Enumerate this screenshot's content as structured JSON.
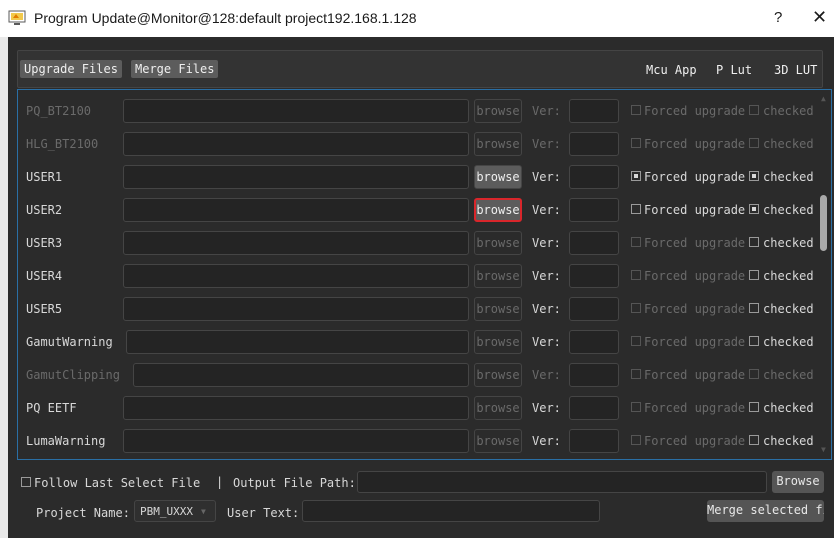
{
  "window": {
    "title": "Program Update@Monitor@128:default project192.168.1.128",
    "help_label": "?",
    "close_label": "✕"
  },
  "top_tabs": {
    "upgrade_files": "Upgrade Files",
    "merge_files": "Merge Files",
    "mcu_app": "Mcu App",
    "p_lut": "P Lut",
    "lut_3d": "3D LUT"
  },
  "labels": {
    "browse": "browse",
    "ver": "Ver:",
    "forced_upgrade": "Forced upgrade",
    "checked": "checked"
  },
  "rows": [
    {
      "name": "PQ_BT2100",
      "enabled": false,
      "forced": false,
      "checked": false
    },
    {
      "name": "HLG_BT2100",
      "enabled": false,
      "forced": false,
      "checked": false
    },
    {
      "name": "USER1",
      "enabled": true,
      "forced": true,
      "checked": true,
      "browse_highlight": true
    },
    {
      "name": "USER2",
      "enabled": true,
      "forced": false,
      "checked": true,
      "browse_focused": true
    },
    {
      "name": "USER3",
      "enabled": true,
      "forced": false,
      "checked": false
    },
    {
      "name": "USER4",
      "enabled": true,
      "forced": false,
      "checked": false
    },
    {
      "name": "USER5",
      "enabled": true,
      "forced": false,
      "checked": false
    },
    {
      "name": "GamutWarning",
      "enabled": true,
      "forced": false,
      "checked": false
    },
    {
      "name": "GamutClipping",
      "enabled": false,
      "forced": false,
      "checked": false
    },
    {
      "name": "PQ EETF",
      "enabled": true,
      "forced": false,
      "checked": false
    },
    {
      "name": "LumaWarning",
      "enabled": true,
      "forced": false,
      "checked": false
    }
  ],
  "bottom": {
    "follow_last": "Follow Last Select File",
    "separator": "|",
    "output_path_label": "Output File Path:",
    "output_path_value": "",
    "browse": "Browse",
    "project_name_label": "Project Name:",
    "project_name_value": "PBM_UXXX",
    "user_text_label": "User Text:",
    "user_text_value": "",
    "merge_selected": "Merge selected file"
  },
  "colors": {
    "highlight_border": "#d9262b",
    "panel_border": "#2a6fa5"
  }
}
